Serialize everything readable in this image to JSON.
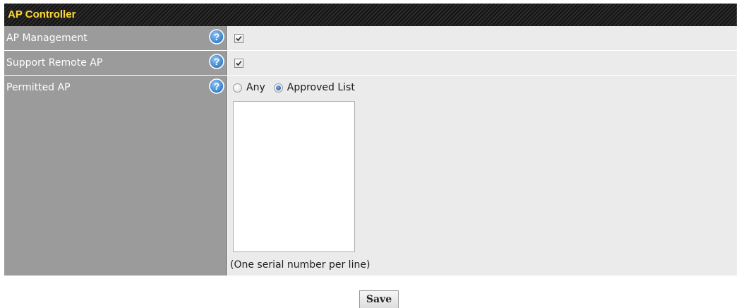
{
  "panel": {
    "title": "AP Controller"
  },
  "rows": [
    {
      "label": "AP Management",
      "help_icon": "question-circle-icon",
      "checked": true
    },
    {
      "label": "Support Remote AP",
      "help_icon": "question-circle-icon",
      "checked": true
    },
    {
      "label": "Permitted AP",
      "help_icon": "question-circle-icon",
      "options": [
        {
          "label": "Any",
          "selected": false
        },
        {
          "label": "Approved List",
          "selected": true
        }
      ],
      "approved_list_value": "",
      "hint": "(One serial number per line)"
    }
  ],
  "save_label": "Save",
  "colors": {
    "header_title": "#f6d43a",
    "label_bg": "#9b9b9b",
    "value_bg": "#ebebeb",
    "help_icon": "#3a86d4"
  }
}
